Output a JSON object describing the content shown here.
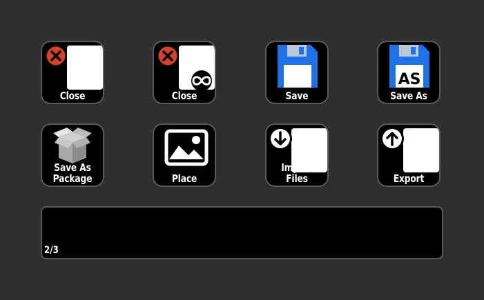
{
  "buttons": [
    {
      "id": "close",
      "label": "Close",
      "icon": "close-document-icon"
    },
    {
      "id": "close-all",
      "label": "Close",
      "icon": "close-all-documents-icon"
    },
    {
      "id": "save",
      "label": "Save",
      "icon": "save-icon"
    },
    {
      "id": "save-as",
      "label": "Save As",
      "icon": "save-as-icon",
      "badge": "AS"
    },
    {
      "id": "save-as-package",
      "label_line1": "Save As",
      "label_line2": "Package",
      "icon": "package-box-icon"
    },
    {
      "id": "place",
      "label": "Place",
      "icon": "image-place-icon"
    },
    {
      "id": "import-files",
      "label": "Import Files",
      "icon": "import-arrow-icon"
    },
    {
      "id": "export",
      "label": "Export",
      "icon": "export-arrow-icon"
    }
  ],
  "strip": {
    "page_indicator": "2/3"
  },
  "colors": {
    "background": "#2e2e2e",
    "key_fill": "#000000",
    "key_border": "#5a5a5a",
    "close_red": "#d8412c",
    "floppy_blue": "#1e73e8",
    "text": "#ffffff"
  }
}
